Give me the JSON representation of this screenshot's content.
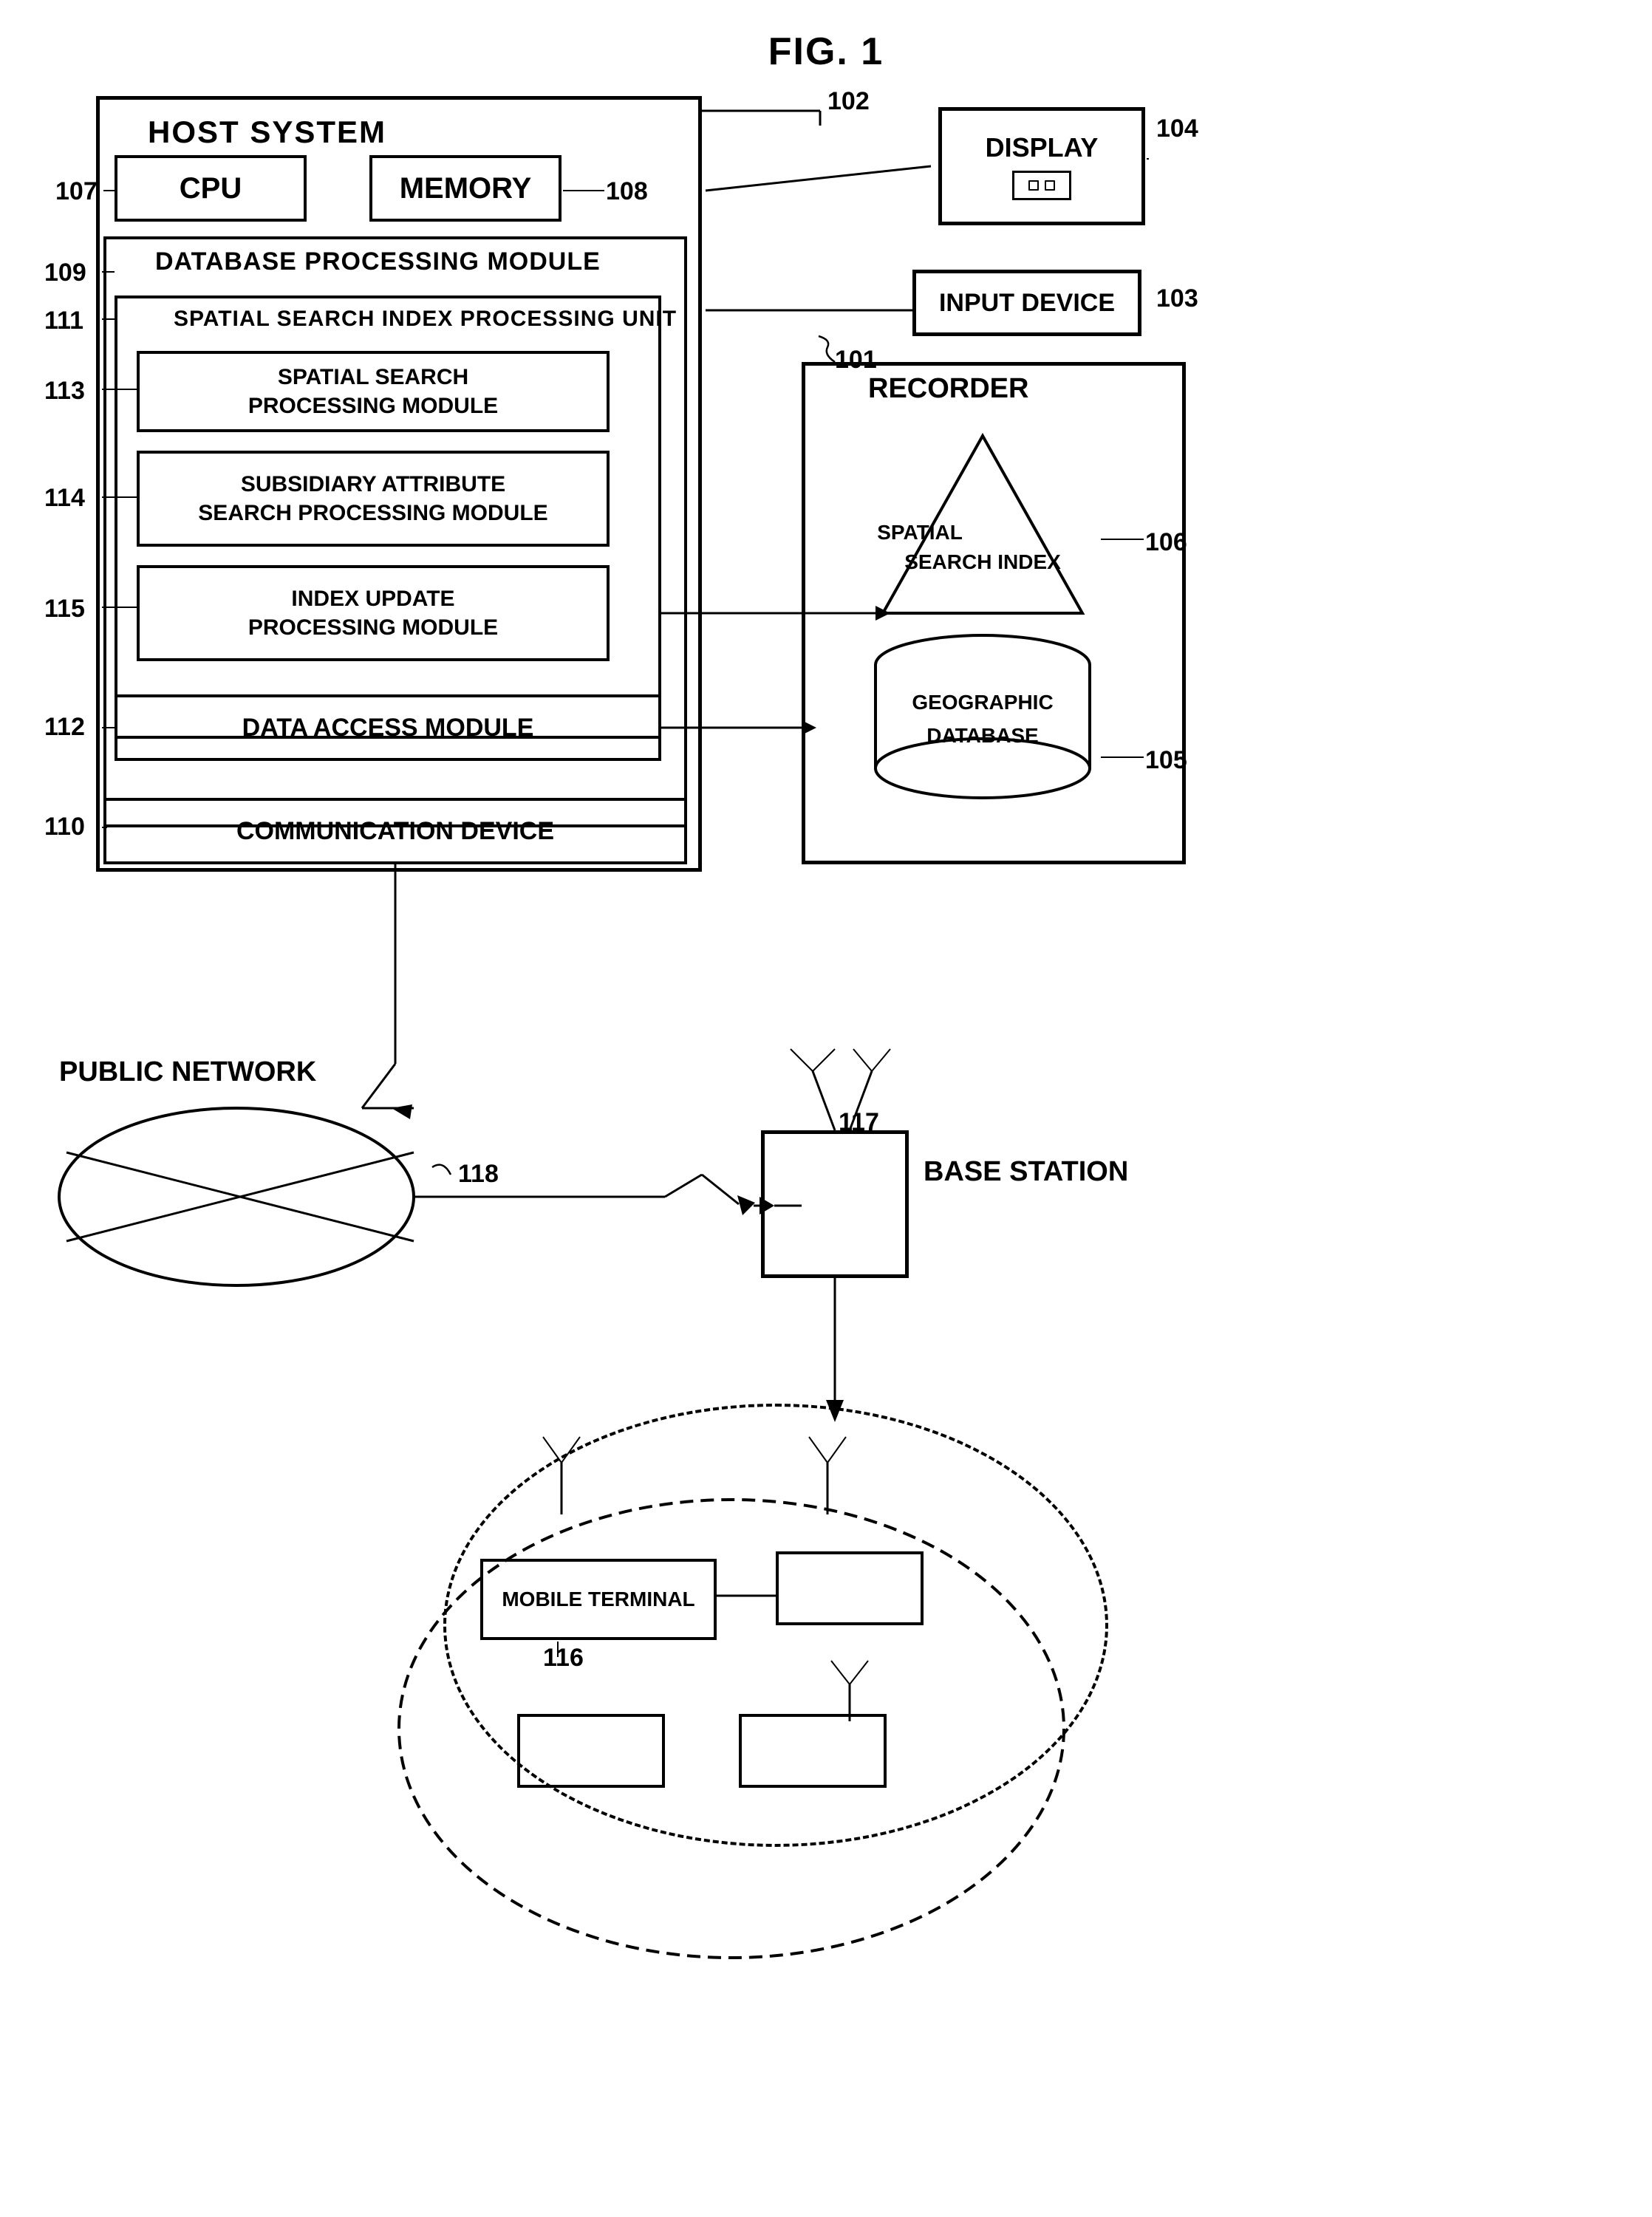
{
  "title": "FIG. 1",
  "components": {
    "host_system": {
      "label": "HOST SYSTEM",
      "ref": "102"
    },
    "cpu": {
      "label": "CPU",
      "ref": "107"
    },
    "memory": {
      "label": "MEMORY",
      "ref": "108"
    },
    "db_processing": {
      "label": "DATABASE PROCESSING MODULE",
      "ref": "109"
    },
    "spatial_index": {
      "label": "SPATIAL SEARCH INDEX PROCESSING UNIT",
      "ref": "111"
    },
    "spatial_search_module": {
      "label": "SPATIAL SEARCH\nPROCESSING MODULE",
      "ref": "113"
    },
    "subsidiary_module": {
      "label": "SUBSIDIARY ATTRIBUTE\nSEARCH PROCESSING MODULE",
      "ref": "114"
    },
    "index_update_module": {
      "label": "INDEX UPDATE\nPROCESSING MODULE",
      "ref": "115"
    },
    "data_access": {
      "label": "DATA ACCESS MODULE",
      "ref": "112"
    },
    "comm_device": {
      "label": "COMMUNICATION DEVICE",
      "ref": "110"
    },
    "display": {
      "label": "DISPLAY",
      "ref": "104"
    },
    "input_device": {
      "label": "INPUT DEVICE",
      "ref": "103"
    },
    "recorder": {
      "label": "RECORDER",
      "ref": "101"
    },
    "spatial_search_index": {
      "label": "SPATIAL\nSEARCH INDEX",
      "ref": "106"
    },
    "geographic_db": {
      "label": "GEOGRAPHIC\nDATABASE",
      "ref": "105"
    },
    "public_network": {
      "label": "PUBLIC NETWORK",
      "ref": "118"
    },
    "base_station": {
      "label": "BASE STATION",
      "ref": "117"
    },
    "mobile_terminal": {
      "label": "MOBILE TERMINAL",
      "ref": "116"
    }
  }
}
